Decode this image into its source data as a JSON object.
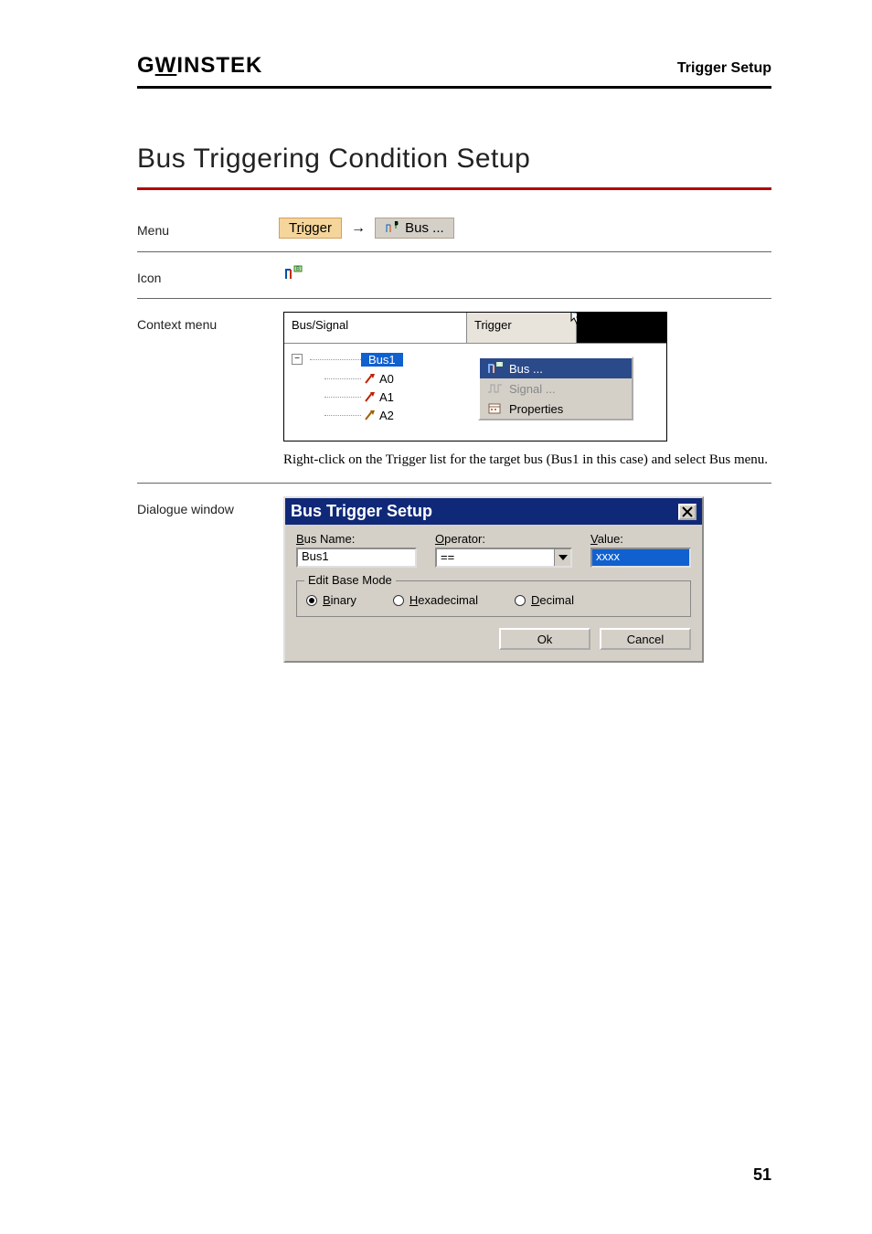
{
  "header": {
    "logo": "GWINSTEK",
    "section": "Trigger Setup"
  },
  "title": "Bus Triggering Condition Setup",
  "rows": {
    "menu_label": "Menu",
    "icon_label": "Icon",
    "context_label": "Context menu",
    "dialogue_label": "Dialogue window"
  },
  "menu": {
    "trigger": "Trigger",
    "bus": "Bus ..."
  },
  "context": {
    "col_bus_signal": "Bus/Signal",
    "col_trigger": "Trigger",
    "bus_name": "Bus1",
    "signals": [
      "A0",
      "A1",
      "A2"
    ],
    "popup": {
      "bus": "Bus ...",
      "signal": "Signal ...",
      "properties": "Properties"
    },
    "caption": "Right-click on the Trigger list for the target bus (Bus1 in this case) and select Bus menu."
  },
  "dialogue": {
    "title": "Bus Trigger Setup",
    "labels": {
      "bus_name": "Bus Name:",
      "operator": "Operator:",
      "value": "Value:",
      "edit_base_mode": "Edit Base Mode",
      "binary": "Binary",
      "hex": "Hexadecimal",
      "decimal": "Decimal",
      "ok": "Ok",
      "cancel": "Cancel"
    },
    "values": {
      "bus_name": "Bus1",
      "operator": "==",
      "value": "xxxx",
      "base_mode": "binary"
    }
  },
  "page_number": "51"
}
